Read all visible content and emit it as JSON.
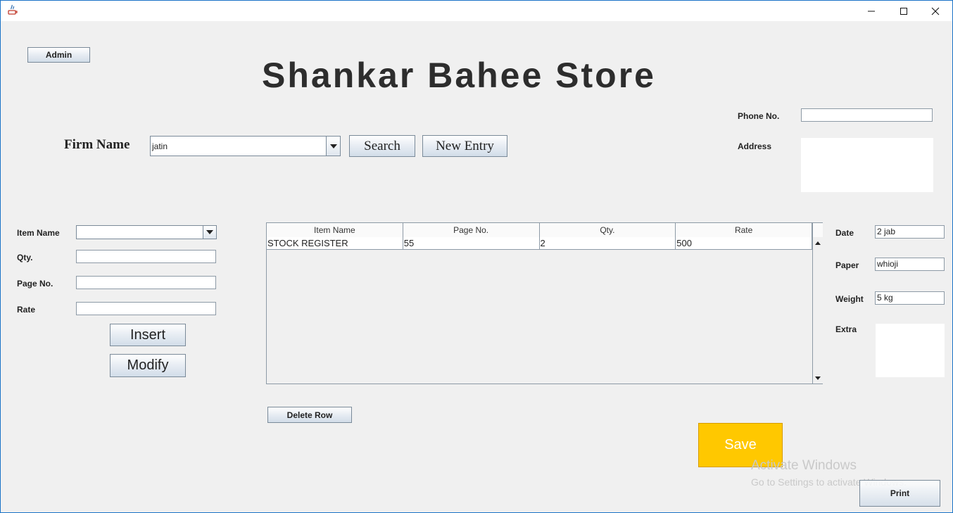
{
  "window": {
    "controls": [
      "minimize",
      "maximize",
      "close"
    ]
  },
  "header": {
    "admin_label": "Admin",
    "store_title": "Shankar Bahee Store"
  },
  "firm": {
    "label": "Firm Name",
    "selected": "jatin",
    "search_label": "Search",
    "new_entry_label": "New Entry"
  },
  "contact": {
    "phone_label": "Phone No.",
    "phone_value": "",
    "address_label": "Address",
    "address_value": ""
  },
  "item_form": {
    "item_name_label": "Item Name",
    "item_name_value": "",
    "qty_label": "Qty.",
    "qty_value": "",
    "page_no_label": "Page No.",
    "page_no_value": "",
    "rate_label": "Rate",
    "rate_value": "",
    "insert_label": "Insert",
    "modify_label": "Modify"
  },
  "table": {
    "columns": [
      "Item Name",
      "Page No.",
      "Qty.",
      "Rate"
    ],
    "rows": [
      [
        "STOCK REGISTER",
        "55",
        "2",
        "500"
      ]
    ]
  },
  "delete_row_label": "Delete Row",
  "details": {
    "date_label": "Date",
    "date_value": "2 jab",
    "paper_label": "Paper",
    "paper_value": "whioji",
    "weight_label": "Weight",
    "weight_value": "5 kg",
    "extra_label": "Extra",
    "extra_value": ""
  },
  "save_label": "Save",
  "print_label": "Print",
  "watermark": {
    "line1": "Activate Windows",
    "line2": "Go to Settings to activate Windows."
  },
  "colors": {
    "save_bg": "#ffc800",
    "window_border": "#1a73c7"
  }
}
